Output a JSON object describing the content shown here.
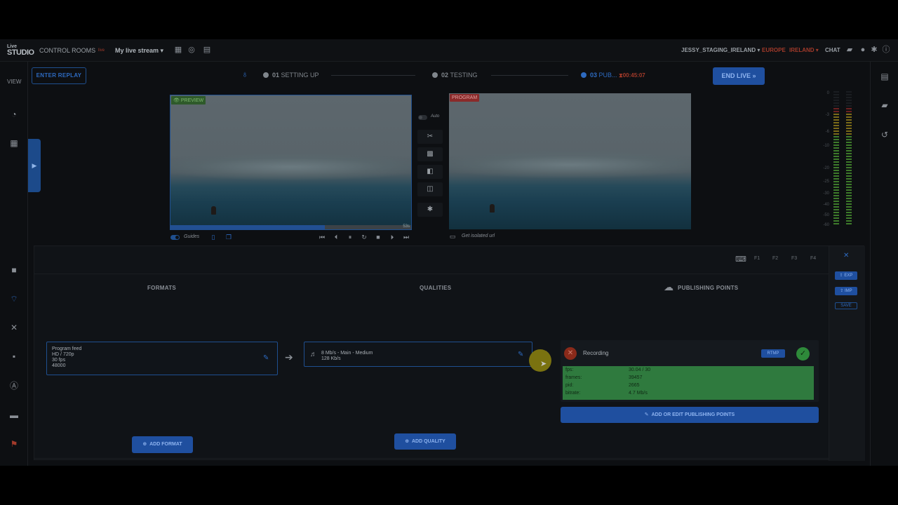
{
  "topbar": {
    "logo_line1": "Live",
    "logo_line2": "STUDIO",
    "control_rooms": "CONTROL ROOMS",
    "live_badge": "live",
    "stream_name": "My live stream",
    "account": "JESSY_STAGING_IRELAND",
    "region_zone": "EUROPE",
    "region_country": "IRELAND",
    "chat": "CHAT"
  },
  "leftbar": {
    "view_label": "VIEW"
  },
  "status": {
    "enter_replay": "ENTER REPLAY",
    "steps": [
      {
        "num": "01",
        "label": "SETTING UP"
      },
      {
        "num": "02",
        "label": "TESTING"
      },
      {
        "num": "03",
        "label": "PUB..."
      }
    ],
    "timer": "00:45:07",
    "end_live": "END LIVE"
  },
  "preview": {
    "tag": "PREVIEW",
    "time": "53s",
    "progress": 0.64,
    "guides_label": "Guides"
  },
  "program": {
    "tag": "PROGRAM",
    "isolated_url": "Get isolated url"
  },
  "switcher": {
    "auto_label": "Auto"
  },
  "meters": {
    "db_labels": [
      "0",
      "-3",
      "-6",
      "-10",
      "-20",
      "-25",
      "-30",
      "-40",
      "-50",
      "-60"
    ]
  },
  "panel": {
    "shortcut_labels": [
      "F1",
      "F2",
      "F3",
      "F4"
    ],
    "formats_title": "FORMATS",
    "qualities_title": "QUALITIES",
    "publishing_title": "PUBLISHING POINTS",
    "format_card": {
      "name": "Program feed",
      "resolution": "HD / 720p",
      "fps": "30 fps",
      "audio": "48000"
    },
    "quality_card": {
      "line1": "8 Mb/s  -  Main  -  Medium",
      "line2": "128 Kb/s"
    },
    "publishing_card": {
      "name": "Recording",
      "protocol": "RTMP",
      "stats": [
        {
          "key": "fps:",
          "value": "30.04 / 30"
        },
        {
          "key": "frames:",
          "value": "39457"
        },
        {
          "key": "pid:",
          "value": "2665"
        },
        {
          "key": "bitrate:",
          "value": "4.7 Mb/s"
        }
      ]
    },
    "add_edit_publishing": "ADD OR EDIT PUBLISHING POINTS",
    "add_quality": "ADD QUALITY",
    "add_format": "ADD FORMAT",
    "side_buttons": [
      "EXP",
      "IMP",
      "SAVE"
    ]
  },
  "colors": {
    "accent": "#1f4f9f",
    "recording_ok": "#2f7a3e",
    "live_red": "#a23a2a"
  }
}
